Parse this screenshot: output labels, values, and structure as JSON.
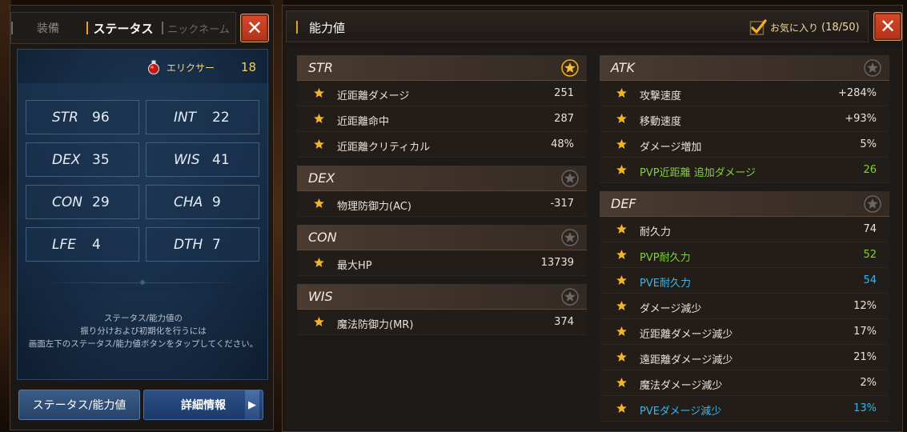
{
  "left": {
    "tabs": [
      {
        "label": "装備"
      },
      {
        "label": "ステータス"
      },
      {
        "label": "ニックネーム"
      }
    ],
    "close_label": "✕",
    "elixir": {
      "label": "エリクサー",
      "value": "18"
    },
    "stats": [
      {
        "name": "STR",
        "value": "96"
      },
      {
        "name": "INT",
        "value": "22"
      },
      {
        "name": "DEX",
        "value": "35"
      },
      {
        "name": "WIS",
        "value": "41"
      },
      {
        "name": "CON",
        "value": "29"
      },
      {
        "name": "CHA",
        "value": "9"
      },
      {
        "name": "LFE",
        "value": "4"
      },
      {
        "name": "DTH",
        "value": "7"
      }
    ],
    "help_lines": [
      "ステータス/能力値の",
      "振り分けおよび初期化を行うには",
      "画面左下のステータス/能力値ボタンをタップしてください。"
    ],
    "btn_status": "ステータス/能力値",
    "btn_detail": "詳細情報"
  },
  "right": {
    "title": "能力値",
    "favorite": {
      "label": "お気に入り",
      "count": "(18/50)"
    },
    "close_label": "✕",
    "sections": {
      "str": {
        "title": "STR",
        "rows": [
          {
            "label": "近距離ダメージ",
            "value": "251"
          },
          {
            "label": "近距離命中",
            "value": "287"
          },
          {
            "label": "近距離クリティカル",
            "value": "48%"
          }
        ]
      },
      "dex": {
        "title": "DEX",
        "rows": [
          {
            "label": "物理防御力(AC)",
            "value": "-317"
          }
        ]
      },
      "con": {
        "title": "CON",
        "rows": [
          {
            "label": "最大HP",
            "value": "13739"
          }
        ]
      },
      "wis": {
        "title": "WIS",
        "rows": [
          {
            "label": "魔法防御力(MR)",
            "value": "374"
          }
        ]
      },
      "atk": {
        "title": "ATK",
        "rows": [
          {
            "label": "攻撃速度",
            "value": "+284%"
          },
          {
            "label": "移動速度",
            "value": "+93%"
          },
          {
            "label": "ダメージ増加",
            "value": "5%"
          },
          {
            "label": "PVP近距離 追加ダメージ",
            "value": "26"
          }
        ]
      },
      "def": {
        "title": "DEF",
        "rows": [
          {
            "label": "耐久力",
            "value": "74"
          },
          {
            "label": "PVP耐久力",
            "value": "52"
          },
          {
            "label": "PVE耐久力",
            "value": "54"
          },
          {
            "label": "ダメージ減少",
            "value": "12%"
          },
          {
            "label": "近距離ダメージ減少",
            "value": "17%"
          },
          {
            "label": "遠距離ダメージ減少",
            "value": "21%"
          },
          {
            "label": "魔法ダメージ減少",
            "value": "2%"
          },
          {
            "label": "PVEダメージ減少",
            "value": "13%"
          }
        ]
      }
    }
  },
  "colors": {
    "accent_gold": "#f0a020",
    "pvp_green": "#7ed23a",
    "pve_blue": "#3ab4ea",
    "close_red": "#c83c20"
  }
}
